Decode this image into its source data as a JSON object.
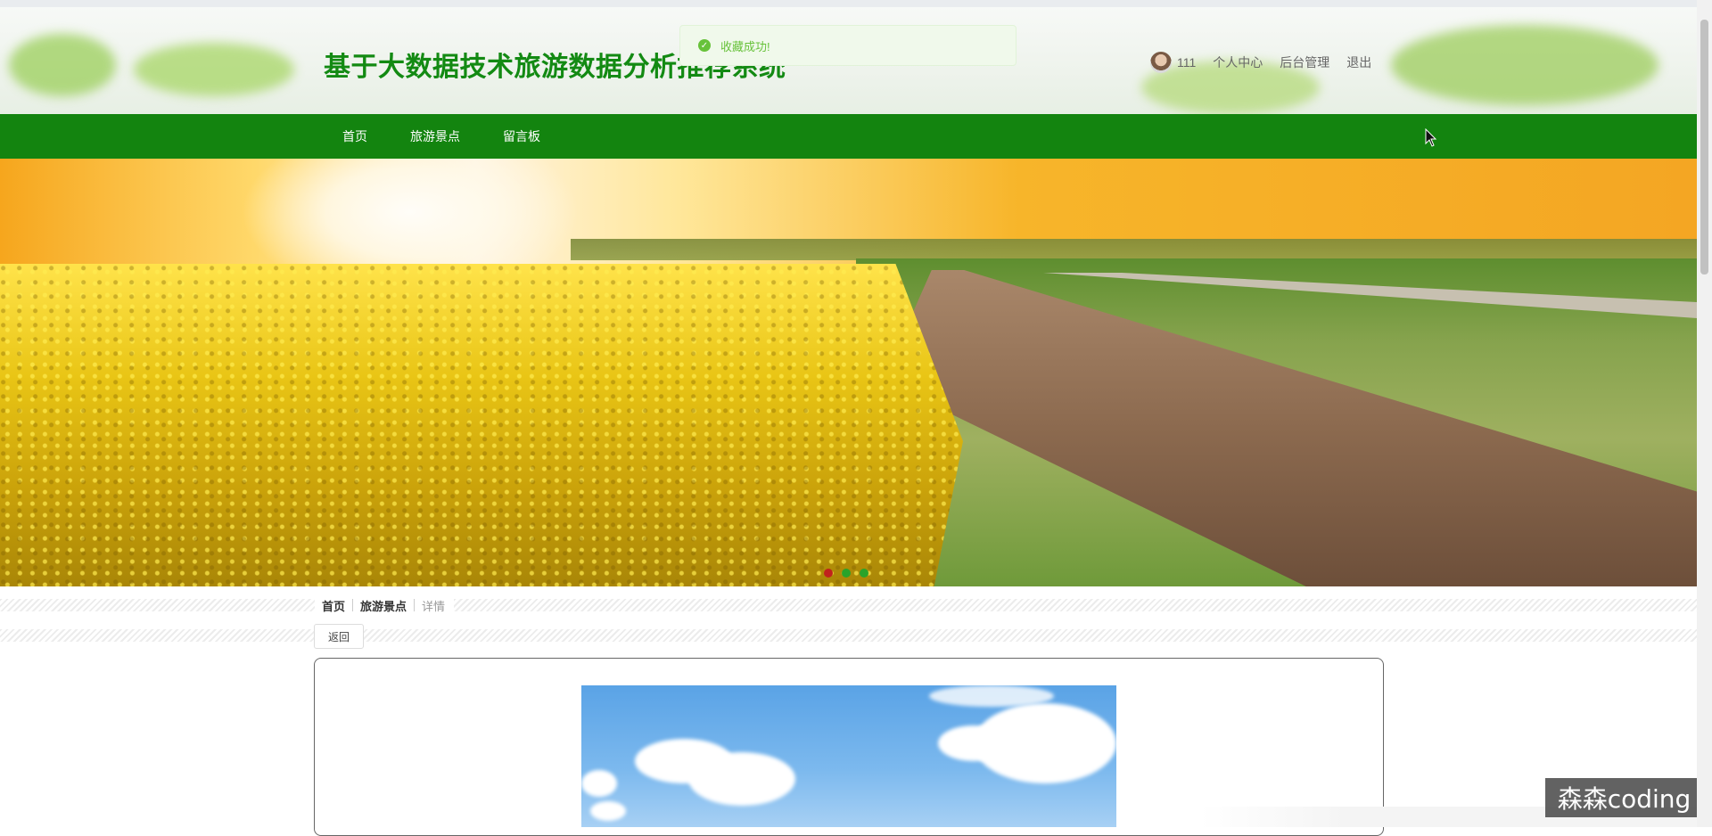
{
  "header": {
    "site_title": "基于大数据技术旅游数据分析推荐系统",
    "user": {
      "username": "111",
      "links": [
        "个人中心",
        "后台管理",
        "退出"
      ]
    }
  },
  "toast": {
    "message": "收藏成功!",
    "type": "success"
  },
  "nav": {
    "items": [
      "首页",
      "旅游景点",
      "留言板"
    ]
  },
  "banner": {
    "slides_total": 3,
    "active_slide": 1
  },
  "breadcrumb": {
    "items": [
      "首页",
      "旅游景点",
      "详情"
    ]
  },
  "actions": {
    "back_label": "返回"
  },
  "watermark": {
    "text": "森森coding"
  },
  "colors": {
    "brand_green": "#13840f",
    "title_green": "#138a13",
    "success_green": "#67c23a"
  }
}
